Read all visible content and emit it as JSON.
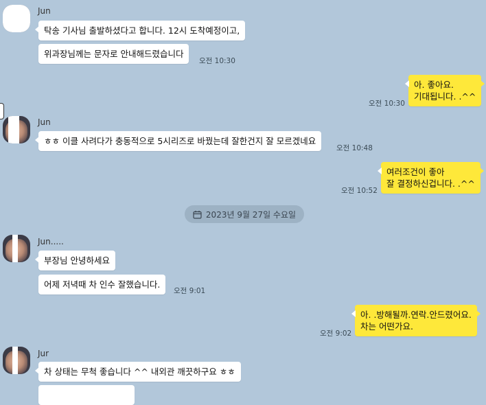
{
  "messages": [
    {
      "id": "m1",
      "sender": "Jun",
      "text": "탁송 기사님 출발하셨다고 합니다. 12시 도착예정이고,"
    },
    {
      "id": "m2",
      "text": "위과장님께는 문자로 안내해드렸습니다",
      "time": "오전 10:30"
    },
    {
      "id": "m3",
      "mine": true,
      "lines": [
        "아. 좋아요.",
        "기대됩니다. .^^"
      ],
      "time": "오전 10:30"
    },
    {
      "id": "m4",
      "sender": "Jun",
      "text": "ㅎㅎ 이클 사려다가 충동적으로 5시리즈로 바꿨는데 잘한건지 잘 모르겠네요",
      "time": "오전 10:48"
    },
    {
      "id": "m5",
      "mine": true,
      "lines": [
        "여러조건이 좋아",
        "잘 결정하신겁니다. .^^"
      ],
      "time": "오전 10:52"
    },
    {
      "id": "m6",
      "sender": "Jun.....",
      "text": "부장님 안녕하세요"
    },
    {
      "id": "m7",
      "text": "어제 저녁때 차 인수 잘했습니다.",
      "time": "오전 9:01"
    },
    {
      "id": "m8",
      "mine": true,
      "lines": [
        "아. .방해될까.연락.안드렸어요.",
        "차는 어떤가요."
      ],
      "time": "오전 9:02"
    },
    {
      "id": "m9",
      "sender": "Jur",
      "text": "차 상태는 무척 좋습니다 ^^ 내외관 깨끗하구요 ㅎㅎ"
    }
  ],
  "date_divider": {
    "icon": "calendar-icon",
    "label": "2023년 9월 27일 수요일"
  },
  "colors": {
    "background": "#b2c7da",
    "my_bubble": "#fee83a",
    "their_bubble": "#ffffff"
  }
}
